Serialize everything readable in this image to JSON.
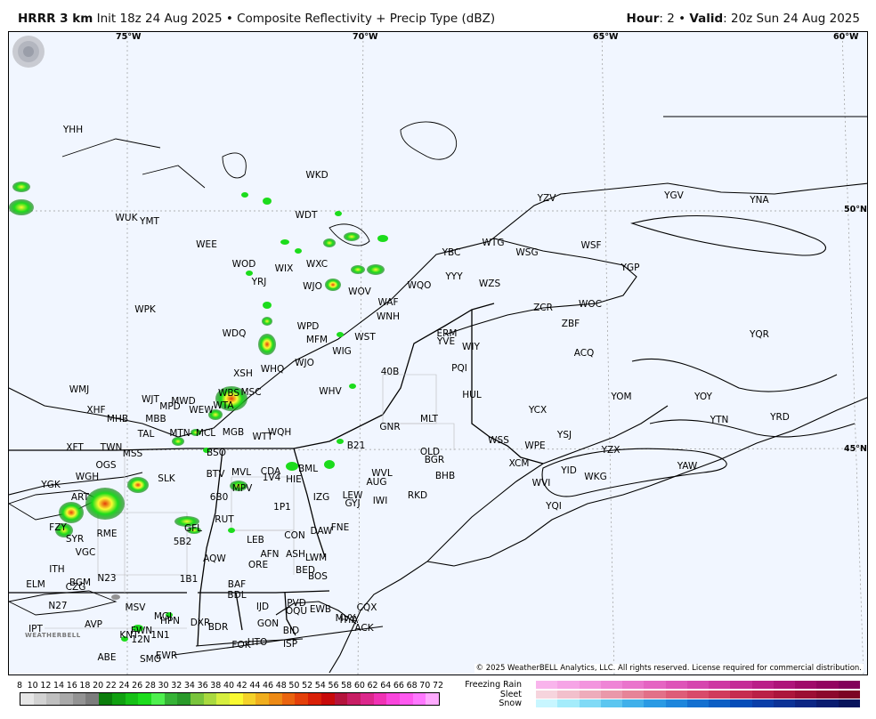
{
  "header": {
    "model": "HRRR 3 km",
    "init": "Init 18z 24 Aug 2025",
    "sep": "•",
    "product": "Composite Reflectivity + Precip Type (dBZ)",
    "hour_label": "Hour",
    "hour_value": ": 2",
    "valid_label": "Valid",
    "valid_value": ": 20z Sun 24 Aug 2025"
  },
  "grid_labels": {
    "lon_75": "75°W",
    "lon_70": "70°W",
    "lon_65": "65°W",
    "lon_60": "60°W",
    "lat_50": "50°N",
    "lat_45": "45°N"
  },
  "stations": [
    "YHH",
    "WKD",
    "YZV",
    "YGV",
    "YNA",
    "WDT",
    "WUK",
    "YMT",
    "WEE",
    "WTG",
    "YBC",
    "WSG",
    "WSF",
    "WOD",
    "WIX",
    "WXC",
    "YRJ",
    "WJO",
    "WOV",
    "YYY",
    "WZS",
    "YGP",
    "WQO",
    "WAF",
    "WNH",
    "ZCR",
    "WOC",
    "WPK",
    "ZBF",
    "ERM",
    "YVE",
    "WDQ",
    "WPD",
    "MFM",
    "WST",
    "WIY",
    "ACQ",
    "YQR",
    "YOY",
    "WIG",
    "WJO",
    "PQI",
    "40B",
    "XSH",
    "WHQ",
    "WHV",
    "HUL",
    "YOM",
    "YTN",
    "YRD",
    "WMJ",
    "WJT",
    "MWD",
    "WBS",
    "MSC",
    "YCX",
    "YSJ",
    "YZX",
    "XHF",
    "MPD",
    "WEW",
    "WTA",
    "GNR",
    "MLT",
    "YAW",
    "MHB",
    "MBB",
    "WSS",
    "WPE",
    "TAL",
    "MTN",
    "MCL",
    "MGB",
    "WTT",
    "WQH",
    "B21",
    "OLD",
    "BGR",
    "XCM",
    "YID",
    "WKG",
    "XFT",
    "TWN",
    "MSS",
    "BSO",
    "WVI",
    "YQI",
    "OGS",
    "SLK",
    "BTV",
    "MVL",
    "CDA",
    "BML",
    "WVL",
    "AUG",
    "RKD",
    "BHB",
    "WGH",
    "MPV",
    "1V4",
    "HIE",
    "IZG",
    "LEW",
    "IWI",
    "GYJ",
    "YGK",
    "ART",
    "6B0",
    "1P1",
    "FZY",
    "RUT",
    "LEB",
    "FNE",
    "DAW",
    "SYR",
    "RME",
    "5B2",
    "GFL",
    "CON",
    "AFN",
    "ASH",
    "LWM",
    "VGC",
    "AQW",
    "ORE",
    "BED",
    "BOS",
    "ITH",
    "1B1",
    "BAF",
    "BDL",
    "ELM",
    "BGM",
    "N23",
    "CZG",
    "N27",
    "MSV",
    "IJD",
    "PVD",
    "OQU",
    "EWB",
    "HYA",
    "CQX",
    "IPT",
    "AVP",
    "MGJ",
    "DXR",
    "GON",
    "BID",
    "ACK",
    "MVY",
    "FWN",
    "HPN",
    "ABE",
    "KNT",
    "12N",
    "SMO",
    "EWR",
    "BDR",
    "ISP",
    "FOK",
    "HTO",
    "1N1"
  ],
  "copyright": "© 2025 WeatherBELL Analytics, LLC. All rights reserved. License required for commercial distribution.",
  "logo_text": "WEATHERBELL",
  "legend": {
    "dbz_ticks": [
      "8",
      "10",
      "12",
      "14",
      "16",
      "18",
      "20",
      "22",
      "24",
      "26",
      "28",
      "30",
      "32",
      "34",
      "36",
      "38",
      "40",
      "42",
      "44",
      "46",
      "48",
      "50",
      "52",
      "54",
      "56",
      "58",
      "60",
      "62",
      "64",
      "66",
      "68",
      "70",
      "72"
    ],
    "dbz_colors": [
      "#e6e6e6",
      "#d2d2d2",
      "#bfbfbf",
      "#a9a9a9",
      "#939393",
      "#7c7c7c",
      "#0b7d0b",
      "#10a010",
      "#16c016",
      "#1cdc1c",
      "#4ef04e",
      "#36b336",
      "#2a9a2a",
      "#79c43c",
      "#a9d93f",
      "#d6ee3f",
      "#fafa32",
      "#f4d22a",
      "#f0ae1e",
      "#ed8a15",
      "#ea640f",
      "#e4400a",
      "#d92007",
      "#c80a0a",
      "#b4143c",
      "#c81e64",
      "#dc288c",
      "#f032b4",
      "#fa46dc",
      "#ff5af0",
      "#ff78ff",
      "#ffaaff"
    ],
    "ptype": [
      {
        "label": "Freezing Rain",
        "colors": [
          "#f9b4ec",
          "#f6a4e6",
          "#f394de",
          "#ef84d6",
          "#ea74cc",
          "#e564c2",
          "#de54b8",
          "#d646ae",
          "#ce38a2",
          "#c52c96",
          "#ba1f88",
          "#ae147a",
          "#a00a6a",
          "#920460",
          "#82005a"
        ]
      },
      {
        "label": "Sleet",
        "colors": [
          "#f6d4dd",
          "#f2c0cc",
          "#eeacbb",
          "#ea98aa",
          "#e68498",
          "#e27088",
          "#de5c78",
          "#d84a6a",
          "#d03a5c",
          "#c62c50",
          "#ba2046",
          "#ac163c",
          "#9c0e34",
          "#8c082c",
          "#7c0424"
        ]
      },
      {
        "label": "Snow",
        "colors": [
          "#c8f6ff",
          "#a4ecfb",
          "#80daf6",
          "#5cc6f0",
          "#40b0ea",
          "#2a9ae4",
          "#1e86dc",
          "#1470d0",
          "#0c5ec4",
          "#064cb8",
          "#0a3ea8",
          "#0c3296",
          "#0c2684",
          "#0a1c70",
          "#08145c"
        ]
      }
    ]
  }
}
